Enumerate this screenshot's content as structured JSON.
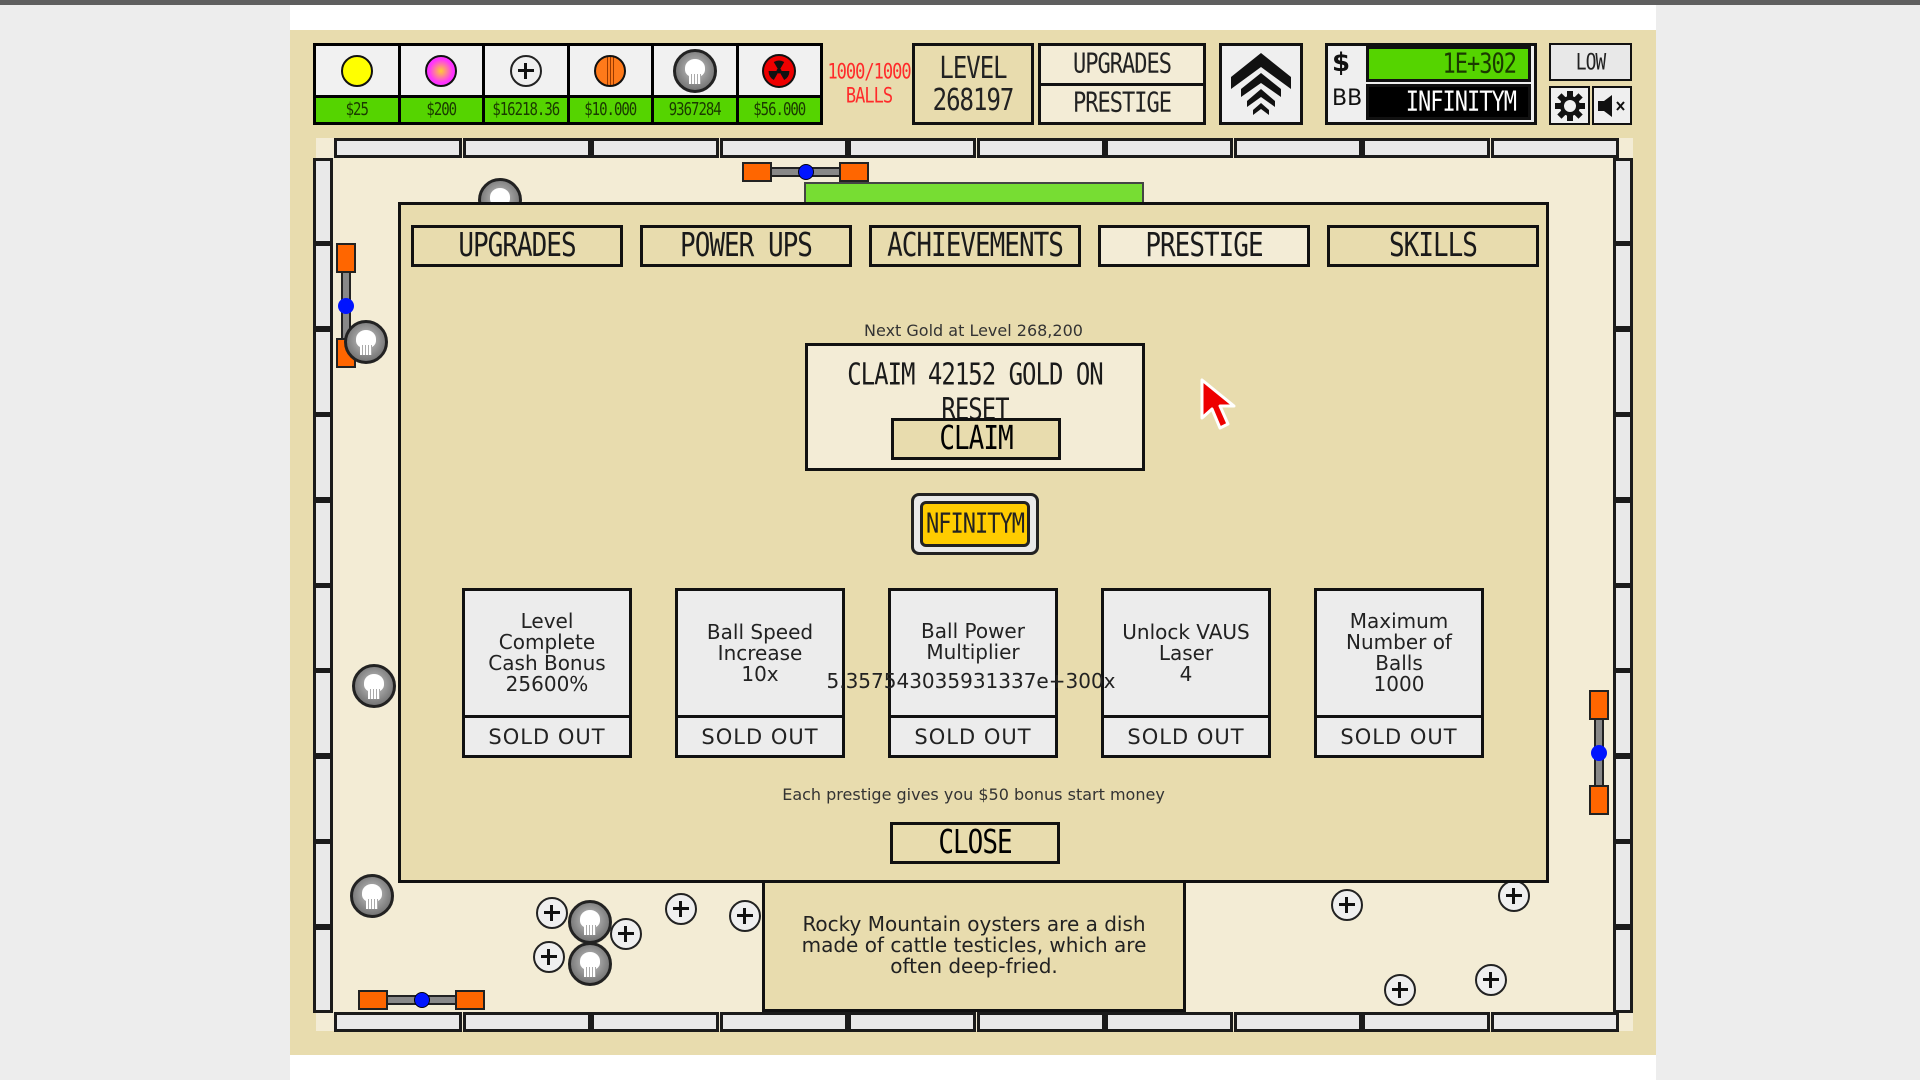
{
  "toolbar": {
    "balls": [
      {
        "icon": "yellow-ball-icon",
        "price": "$25",
        "color": "#ffff00"
      },
      {
        "icon": "pink-ball-icon",
        "price": "$200",
        "color": "#ff33ff"
      },
      {
        "icon": "plus-ball-icon",
        "price": "$16218.36",
        "color": "#f1f1f1"
      },
      {
        "icon": "orange-striped-ball-icon",
        "price": "$10.000",
        "color": "#ff7a1a"
      },
      {
        "icon": "skull-ball-icon",
        "price": "9367284",
        "color": "#888888"
      },
      {
        "icon": "radioactive-ball-icon",
        "price": "$56.000",
        "color": "#ee0000"
      }
    ],
    "balls_count": "1000/1000",
    "balls_label": "BALLS",
    "level_label": "LEVEL",
    "level_value": "268197",
    "upgrades_label": "UPGRADES",
    "prestige_label": "PRESTIGE",
    "arrow_icon": "triple-chevron-up-icon",
    "money_symbol": "$",
    "money_value": "1E+302",
    "bb_label": "BB",
    "bb_value": "INFINITYM",
    "quality_label": "LOW",
    "settings_icon": "gear-icon",
    "mute_icon": "speaker-muted-icon"
  },
  "colors": {
    "accent_green": "#55d400",
    "game_bg": "#e8dcae",
    "field_bg": "#f3ecd5",
    "paddle_orange": "#ff6600",
    "paddle_dot": "#0014ff",
    "gold": "#ffcc00",
    "balls_red": "#ff2a2a"
  },
  "modal": {
    "tabs": [
      {
        "label": "UPGRADES",
        "active": false
      },
      {
        "label": "POWER UPS",
        "active": false
      },
      {
        "label": "ACHIEVEMENTS",
        "active": false
      },
      {
        "label": "PRESTIGE",
        "active": true
      },
      {
        "label": "SKILLS",
        "active": false
      }
    ],
    "next_gold": "Next Gold at Level 268,200",
    "claim_text": "CLAIM 42152 GOLD ON RESET",
    "claim_button": "CLAIM",
    "gold_badge": "NFINITYM",
    "cards": [
      {
        "desc": "Level\nComplete\nCash Bonus\n25600%",
        "status": "SOLD OUT"
      },
      {
        "desc": "Ball Speed\nIncrease\n10x",
        "status": "SOLD OUT"
      },
      {
        "desc": "Ball Power\nMultiplier\n ",
        "status": "SOLD OUT"
      },
      {
        "desc": "Unlock VAUS\nLaser\n4",
        "status": "SOLD OUT"
      },
      {
        "desc": "Maximum\nNumber of\nBalls\n1000",
        "status": "SOLD OUT"
      }
    ],
    "power_multiplier_value": "5.357543035931337e+300x",
    "bonus_note": "Each prestige gives you $50 bonus start money",
    "close_button": "CLOSE"
  },
  "fact": "Rocky Mountain oysters are a dish made of cattle testicles, which are often deep-fried."
}
